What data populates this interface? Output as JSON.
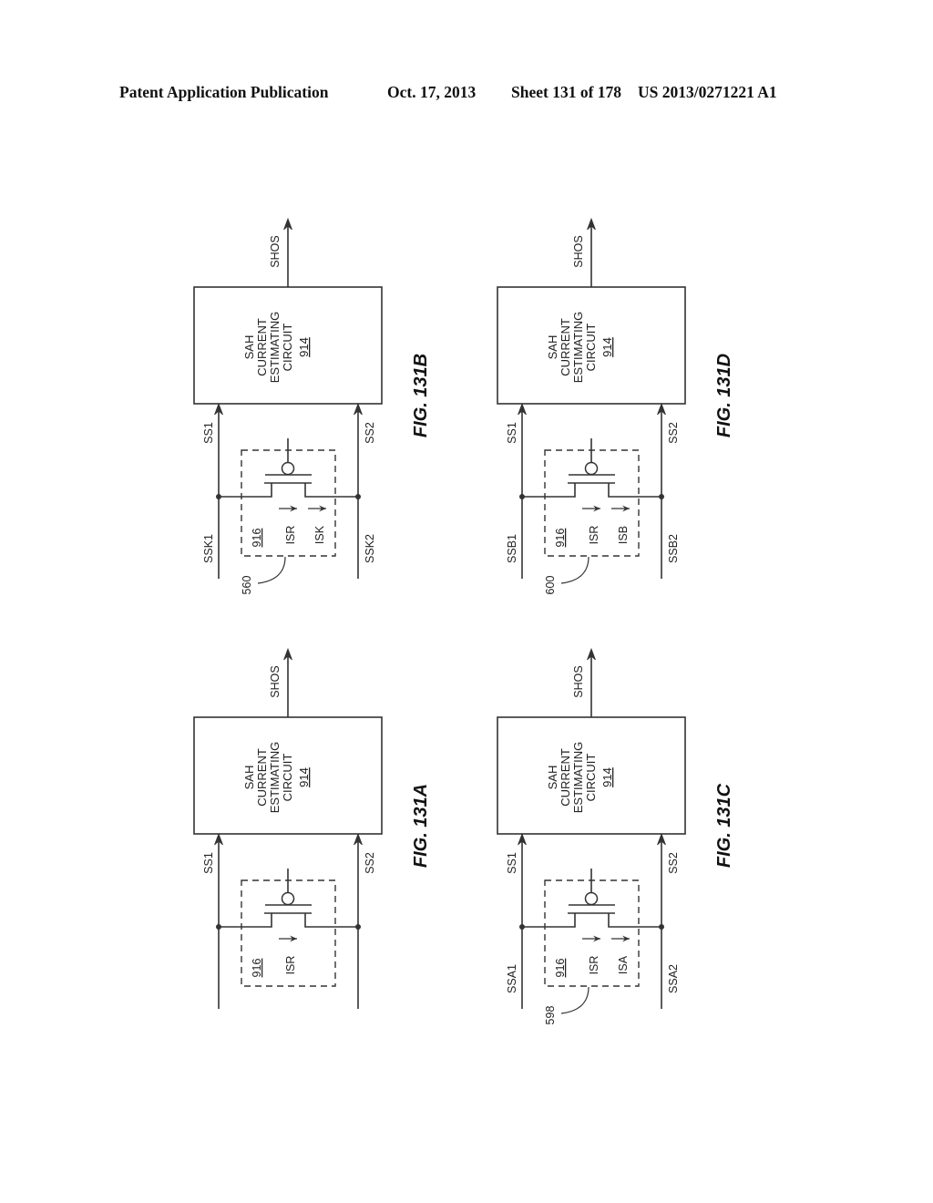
{
  "header": {
    "publication": "Patent Application Publication",
    "date": "Oct. 17, 2013",
    "sheet": "Sheet 131 of 178",
    "number": "US 2013/0271221 A1"
  },
  "figures": [
    {
      "id": "131B",
      "label": "FIG. 131B",
      "output_signal": "SHOS",
      "block_lines": [
        "SAH",
        "CURRENT",
        "ESTIMATING",
        "CIRCUIT"
      ],
      "block_ref": "914",
      "sub_ref": "916",
      "input1": "SS1",
      "input2": "SS2",
      "source1": "SSK1",
      "source2": "SSK2",
      "currents": [
        "ISR",
        "ISK"
      ],
      "callout_ref": "560"
    },
    {
      "id": "131D",
      "label": "FIG. 131D",
      "output_signal": "SHOS",
      "block_lines": [
        "SAH",
        "CURRENT",
        "ESTIMATING",
        "CIRCUIT"
      ],
      "block_ref": "914",
      "sub_ref": "916",
      "input1": "SS1",
      "input2": "SS2",
      "source1": "SSB1",
      "source2": "SSB2",
      "currents": [
        "ISR",
        "ISB"
      ],
      "callout_ref": "600"
    },
    {
      "id": "131A",
      "label": "FIG. 131A",
      "output_signal": "SHOS",
      "block_lines": [
        "SAH",
        "CURRENT",
        "ESTIMATING",
        "CIRCUIT"
      ],
      "block_ref": "914",
      "sub_ref": "916",
      "input1": "SS1",
      "input2": "SS2",
      "source1": "",
      "source2": "",
      "currents": [
        "ISR"
      ],
      "callout_ref": ""
    },
    {
      "id": "131C",
      "label": "FIG. 131C",
      "output_signal": "SHOS",
      "block_lines": [
        "SAH",
        "CURRENT",
        "ESTIMATING",
        "CIRCUIT"
      ],
      "block_ref": "914",
      "sub_ref": "916",
      "input1": "SS1",
      "input2": "SS2",
      "source1": "SSA1",
      "source2": "SSA2",
      "currents": [
        "ISR",
        "ISA"
      ],
      "callout_ref": "598"
    }
  ]
}
